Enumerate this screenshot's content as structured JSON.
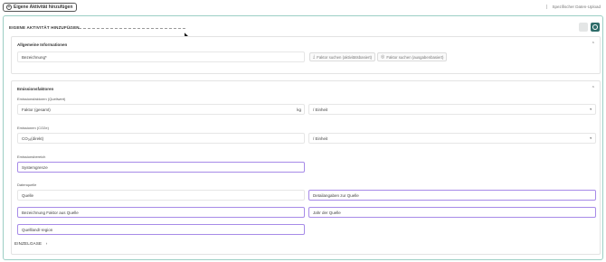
{
  "top": {
    "add_button_label": "Eigene Aktivität hinzufügen",
    "add_icon": "+",
    "upload_link": "Spezifischer Daten-Upload"
  },
  "card": {
    "title": "EIGENE AKTIVITÄT HINZUFÜGEN"
  },
  "general": {
    "title": "Allgemeine Informationen",
    "designation_label": "Bezeichnung*",
    "search_activity_label": "Faktor suchen (aktivitätsbasiert)",
    "search_expense_label": "Faktor suchen (ausgabenbasiert)"
  },
  "emission": {
    "title": "Emissionsfaktoren",
    "factors_label": "Emissionsfaktoren (Quellwert)",
    "factor_total": "Faktor (gesamt)",
    "factor_unit": "kg",
    "unit_select": "/ Einheit",
    "emissions_label": "Emissionen (CO2e)",
    "co2_direct": "CO₂ₑ(direkt)",
    "unit_select_2": "/ Einheit",
    "range_label": "Emissionsbereich",
    "system_boundary": "Systemgrenze",
    "source_label": "Datenquelle",
    "source": "Quelle",
    "source_details": "Detailangaben zur Quelle",
    "source_factor_name": "Bezeichnung Faktor aus Quelle",
    "source_year": "Jahr der Quelle",
    "source_region": "Quellland/-region",
    "single_gases": "EINZELGASE"
  },
  "icons": {
    "chevron_up": "⌃",
    "chevron_right": "›",
    "caret_down": "▾",
    "download": "⤓",
    "eye": "◎"
  },
  "colors": {
    "accent": "#2f6d6a",
    "card_border": "#9ccfc5",
    "highlight": "#a78be8"
  }
}
